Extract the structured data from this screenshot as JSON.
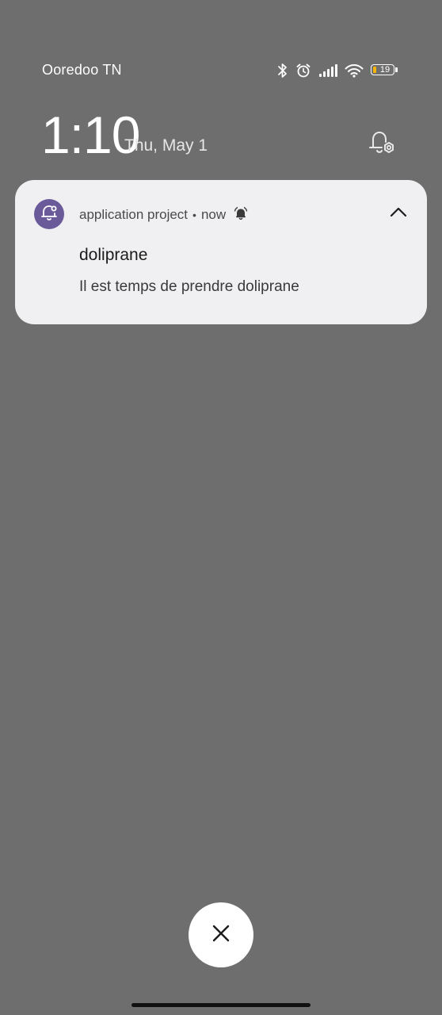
{
  "status_bar": {
    "carrier": "Ooredoo TN",
    "battery_level": "19",
    "icons": [
      "bluetooth-icon",
      "alarm-clock-icon",
      "signal-bars-icon",
      "wifi-icon",
      "battery-icon"
    ]
  },
  "lockscreen": {
    "time": "1:10",
    "date": "Thu, May 1",
    "notification_settings_icon": "bell-settings-icon"
  },
  "notification": {
    "app_name": "application project",
    "separator": "•",
    "timestamp": "now",
    "title": "doliprane",
    "body": "Il est temps de prendre doliprane",
    "app_icon": "reminder-bell-icon",
    "alert_icon": "alarm-bell-icon",
    "collapse_icon": "chevron-up-icon",
    "accent_color": "#6a5a9a"
  },
  "dismiss": {
    "icon": "close-icon"
  },
  "colors": {
    "background": "#6e6e6e",
    "card": "#f0eff1",
    "battery_fill": "#f5b400"
  }
}
